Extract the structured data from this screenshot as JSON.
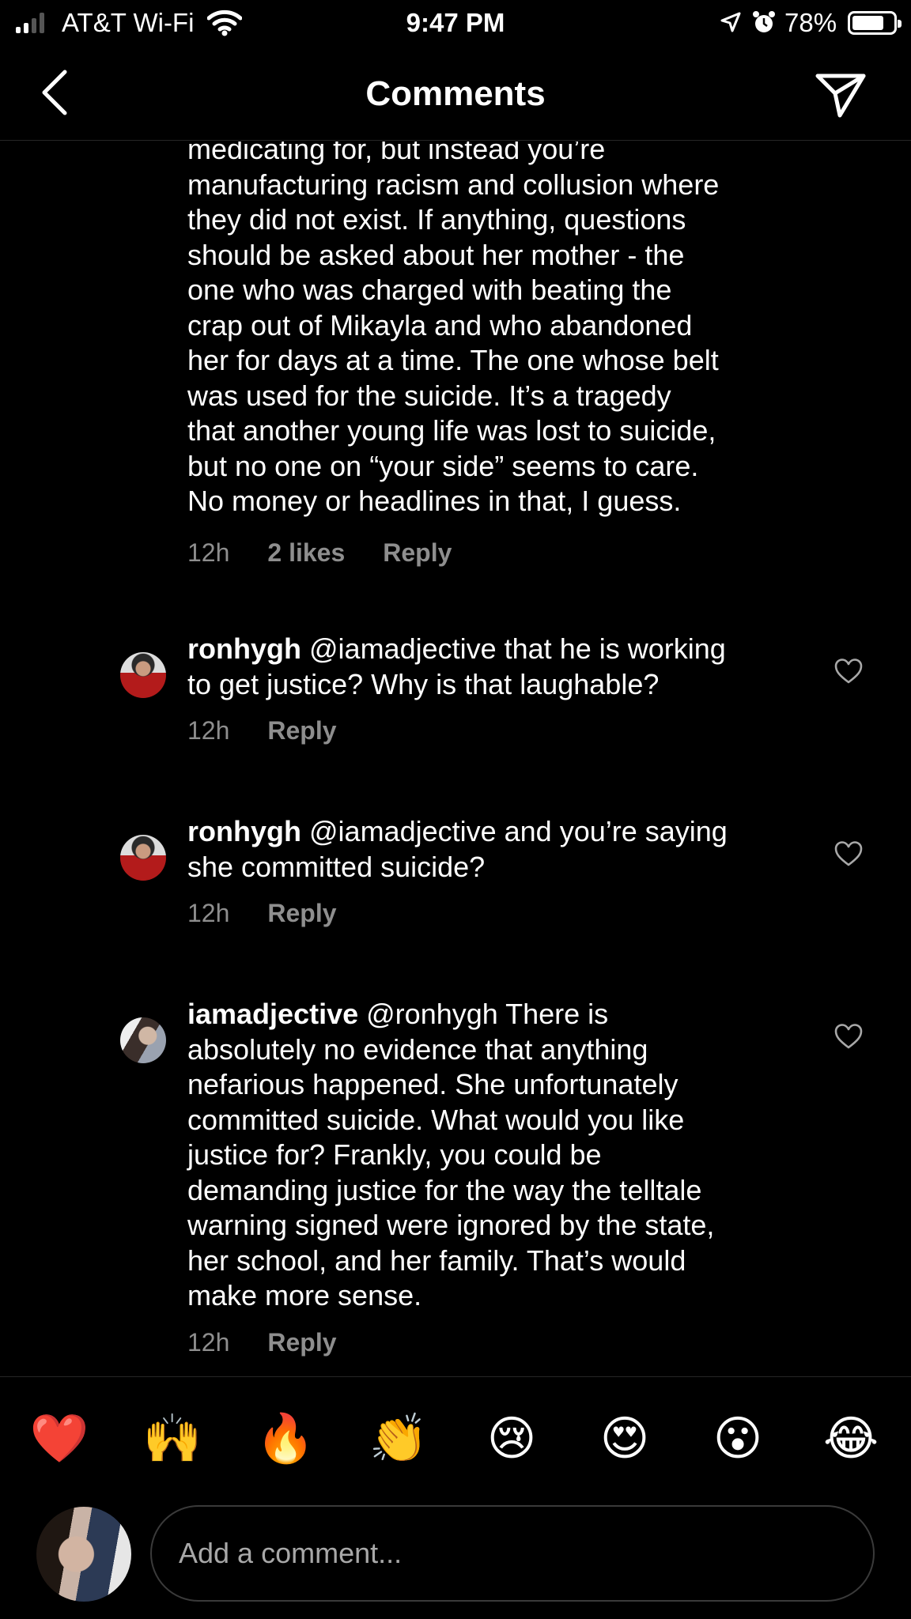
{
  "status_bar": {
    "carrier": "AT&T Wi-Fi",
    "time": "9:47 PM",
    "battery": "78%",
    "battery_level": 0.78
  },
  "header": {
    "title": "Comments"
  },
  "continued_comment": {
    "lines": [
      "medicating for, but instead you’re",
      "manufacturing racism and collusion where",
      "they did not exist. If anything, questions",
      "should be asked about her mother - the",
      "one who was charged with beating the",
      "crap out of Mikayla and who abandoned",
      "her for days at a time. The one whose belt",
      "was used for the suicide. It’s a tragedy",
      "that another young life was lost to suicide,",
      "but no one on “your side” seems to care.",
      "No money or headlines in that, I guess."
    ],
    "time": "12h",
    "likes": "2 likes",
    "reply": "Reply"
  },
  "comments": [
    {
      "username": "ronhygh",
      "first_line": "@iamadjective that he is working",
      "lines": [
        "to get justice? Why is that laughable?"
      ],
      "time": "12h",
      "reply": "Reply"
    },
    {
      "username": "ronhygh",
      "first_line": "@iamadjective and you’re saying",
      "lines": [
        "she committed suicide?"
      ],
      "time": "12h",
      "reply": "Reply"
    },
    {
      "username": "iamadjective",
      "first_line": "@ronhygh There is",
      "lines": [
        "absolutely no evidence that anything",
        "nefarious happened. She unfortunately",
        "committed suicide. What would you like",
        "justice for? Frankly, you could be",
        "demanding justice for the way the telltale",
        "warning signed were ignored by the state,",
        "her school, and her family. That’s would",
        "make more sense."
      ],
      "time": "12h",
      "reply": "Reply"
    }
  ],
  "emoji_bar": [
    "❤️",
    "🙌",
    "🔥",
    "👏",
    "😢",
    "😍",
    "😮",
    "😂"
  ],
  "composer": {
    "placeholder": "Add a comment..."
  }
}
